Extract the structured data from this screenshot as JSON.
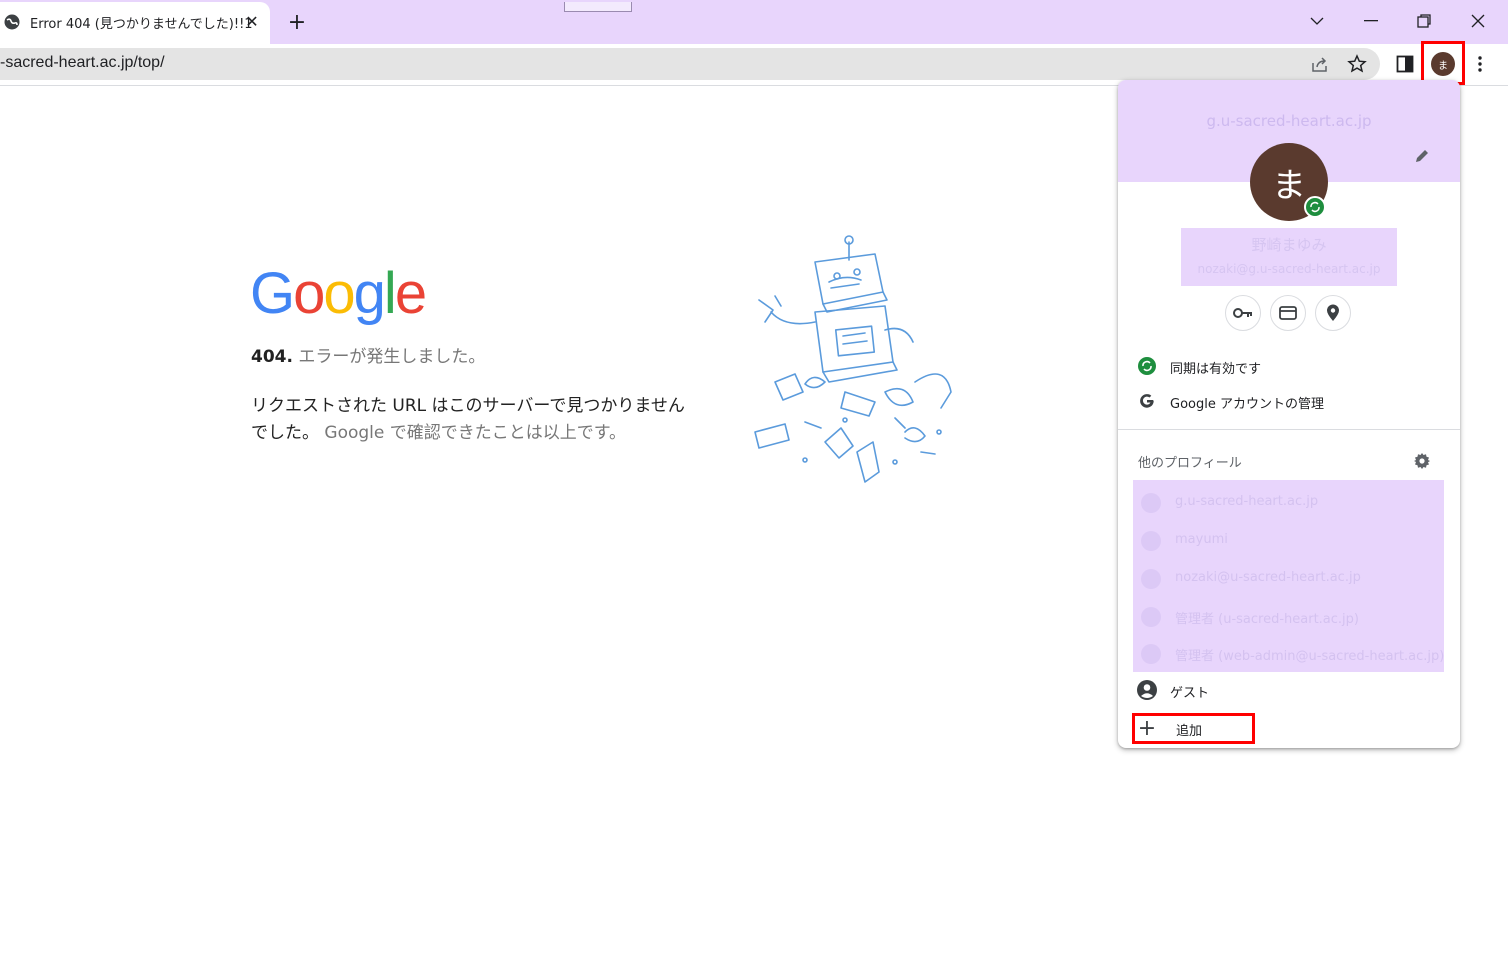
{
  "browser": {
    "tab_title": "Error 404 (見つかりませんでした)!!1",
    "url": "-sacred-heart.ac.jp/top/",
    "new_tab_symbol": "+",
    "close_symbol": "✕",
    "window_controls": {
      "dropdown": "⌄",
      "minimize": "—",
      "restore": "❐",
      "close": "✕"
    },
    "profile_initial": "ま"
  },
  "error_page": {
    "logo_letters": [
      "G",
      "o",
      "o",
      "g",
      "l",
      "e"
    ],
    "logo_colors": [
      "#4285F4",
      "#EA4335",
      "#FBBC05",
      "#4285F4",
      "#34A853",
      "#EA4335"
    ],
    "code": "404.",
    "line1": "エラーが発生しました。",
    "line2a": "リクエストされた URL はこのサーバーで見つかりません",
    "line2b": "でした。",
    "line2c": "Google で確認できたことは以上です。"
  },
  "profile_menu": {
    "domain": "g.u-sacred-heart.ac.jp",
    "avatar_initial": "ま",
    "name": "野崎まゆみ",
    "email": "nozaki@g.u-sacred-heart.ac.jp",
    "sync_label": "同期は有効です",
    "manage_account_label": "Google アカウントの管理",
    "other_profiles_label": "他のプロフィール",
    "profiles": [
      {
        "label": "g.u-sacred-heart.ac.jp",
        "icon": "person-icon"
      },
      {
        "label": "mayumi",
        "icon": "avatar-icon"
      },
      {
        "label": "nozaki@u-sacred-heart.ac.jp",
        "icon": "person-icon"
      },
      {
        "label": "管理者 (u-sacred-heart.ac.jp)",
        "icon": "avatar-icon"
      },
      {
        "label": "管理者 (web-admin@u-sacred-heart.ac.jp)",
        "icon": "avatar-icon"
      }
    ],
    "guest_label": "ゲスト",
    "add_label": "追加",
    "add_symbol": "+"
  },
  "colors": {
    "accent_purple": "#e8d5fc",
    "highlight_red": "#ff0000",
    "sync_green": "#1e8e3e",
    "avatar_brown": "#5a3a2e"
  }
}
